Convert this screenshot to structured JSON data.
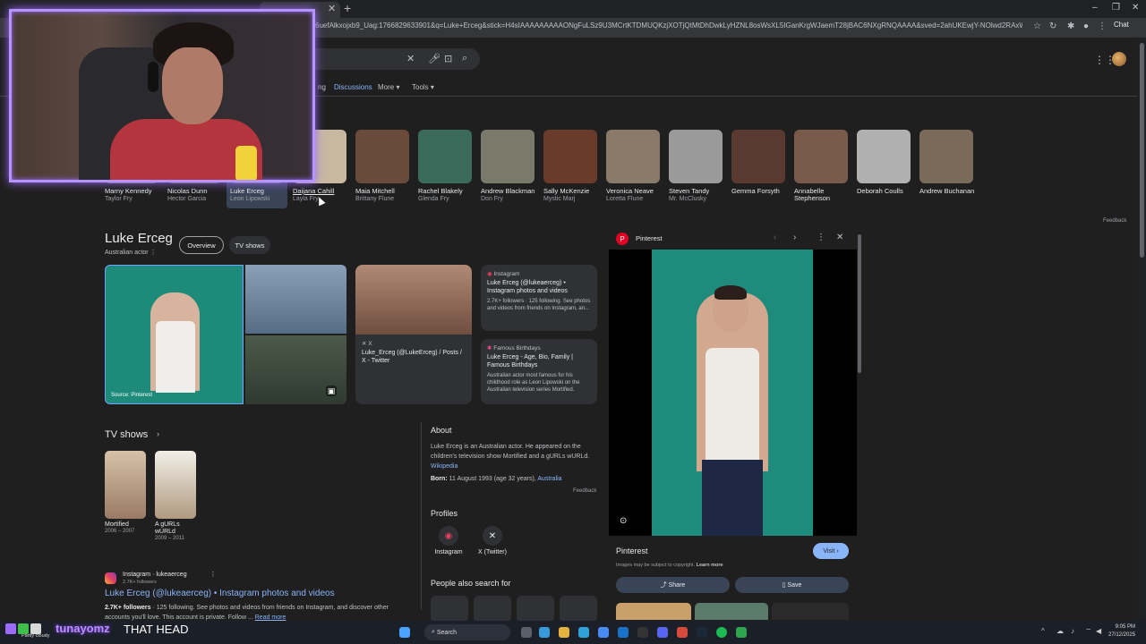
{
  "browser": {
    "url": "6uefAlkxojxb9_Uag:1766829633901&q=Luke+Erceg&stick=H4sIAAAAAAAAAONgFuLSz9U3MCrtKTDMUQKzjXOTjQtMtDhDwkLyHZNL8osWsXL5IGanKrgWJaemT28jBAC6NXgRNQAAAA&sved=2ahUKEwjY-NOlwd2RAxWpqFYBHaJwMp0Q-8Z6BAgYEBA&biw=1280",
    "chat_label": "Chat"
  },
  "google": {
    "nav": [
      "Discussions",
      "More",
      "Tools"
    ],
    "nav_partial": "ng"
  },
  "people": [
    {
      "name": "Marny Kennedy",
      "role": "Taylor Fry",
      "color": "#8a7a6a"
    },
    {
      "name": "Nicolas Dunn",
      "role": "Hector Garcia",
      "color": "#7a6652"
    },
    {
      "name": "Luke Erceg",
      "role": "Leon Lipowski",
      "color": "#6f7f8a"
    },
    {
      "name": "Daijana Cahill",
      "role": "Layla Fry",
      "color": "#c8b8a0"
    },
    {
      "name": "Maia Mitchell",
      "role": "Brittany Flune",
      "color": "#6a4a3a"
    },
    {
      "name": "Rachel Blakely",
      "role": "Glenda Fry",
      "color": "#3a6a5a"
    },
    {
      "name": "Andrew Blackman",
      "role": "Don Fry",
      "color": "#7a7a6a"
    },
    {
      "name": "Sally McKenzie",
      "role": "Mystic Marj",
      "color": "#6a3a2a"
    },
    {
      "name": "Veronica Neave",
      "role": "Loretta Flune",
      "color": "#8a7a6a"
    },
    {
      "name": "Steven Tandy",
      "role": "Mr. McClusky",
      "color": "#9a9a9a"
    },
    {
      "name": "Gemma Forsyth",
      "role": "",
      "color": "#5a3a30"
    },
    {
      "name": "Annabelle Stephenson",
      "role": "",
      "color": "#7a5a4a"
    },
    {
      "name": "Deborah Coulls",
      "role": "",
      "color": "#b0b0b0"
    },
    {
      "name": "Andrew Buchanan",
      "role": "",
      "color": "#7a6a5a"
    }
  ],
  "feedback": "Feedback",
  "kp": {
    "title": "Luke Erceg",
    "subtitle": "Australian actor",
    "tabs": [
      "Overview",
      "TV shows"
    ],
    "image_source": "Source: Pinterest"
  },
  "cards": {
    "x": {
      "source": "X",
      "title": "Luke_Erceg (@LukeErceg) / Posts / X - Twitter"
    },
    "instagram": {
      "source": "Instagram",
      "title": "Luke Erceg (@lukeaerceg) • Instagram photos and videos",
      "desc": "2.7K+ followers · 125 following. See photos and videos from friends on Instagram, an..."
    },
    "famous": {
      "source": "Famous Birthdays",
      "title": "Luke Erceg - Age, Bio, Family | Famous Birthdays",
      "desc": "Australian actor most famous for his childhood role as Leon Lipowski on the Australian television series Mortified."
    }
  },
  "tv_shows": {
    "heading": "TV shows",
    "items": [
      {
        "name": "Mortified",
        "years": "2006 – 2007"
      },
      {
        "name": "A gURLs wURLd",
        "years": "2009 – 2011"
      }
    ]
  },
  "ig_result": {
    "site": "Instagram · lukeaerceg",
    "followers": "2.7K+ followers",
    "title": "Luke Erceg (@lukeaerceg) • Instagram photos and videos",
    "snippet_bold": "2.7K+ followers",
    "snippet": " · 125 following. See photos and videos from friends on Instagram, and discover other accounts you'll love. This account is private. Follow ...",
    "read_more": "Read more"
  },
  "about": {
    "heading": "About",
    "text": "Luke Erceg is an Australian actor. He appeared on the children's television show Mortified and a gURLs wURLd.",
    "source": "Wikipedia",
    "born_label": "Born:",
    "born_value": " 11 August 1993 (age 32 years), ",
    "born_place": "Australia"
  },
  "profiles": {
    "heading": "Profiles",
    "items": [
      "Instagram",
      "X (Twitter)"
    ]
  },
  "people_also": "People also search for",
  "viewer": {
    "site": "Pinterest",
    "footer_site": "Pinterest",
    "visit": "Visit ›",
    "copyright": "Images may be subject to copyright.",
    "learn_more": "Learn more",
    "share": "Share",
    "save": "Save"
  },
  "stream": {
    "username": "tunayomz",
    "message": "THAT HEAD"
  },
  "taskbar": {
    "weather": "Partly cloudy",
    "search": "Search",
    "time": "9:05 PM",
    "date": "27/12/2025"
  }
}
